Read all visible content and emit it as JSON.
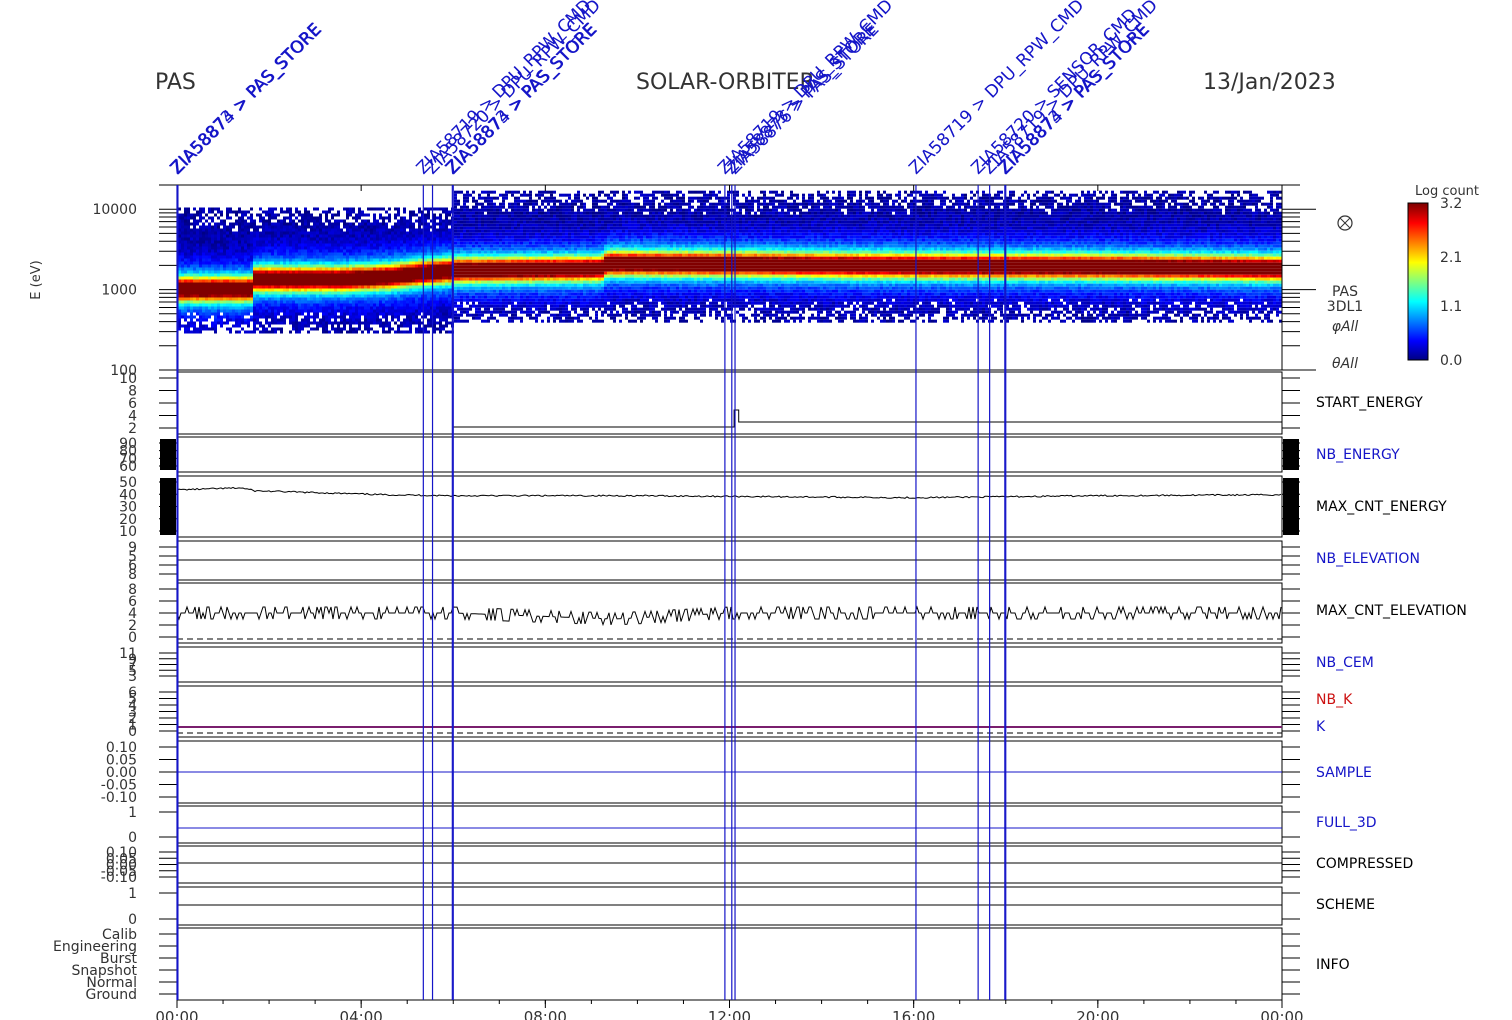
{
  "header": {
    "left": "PAS",
    "center": "SOLAR-ORBITER",
    "right": "13/Jan/2023"
  },
  "chart_data": {
    "type": "heatmap",
    "title": "SOLAR-ORBITER",
    "instrument": "PAS",
    "date": "13/Jan/2023",
    "x_ticks": [
      "00:00",
      "04:00",
      "08:00",
      "12:00",
      "16:00",
      "20:00",
      "00:00"
    ],
    "x_range_hours": [
      0,
      24
    ],
    "spectrogram": {
      "ylabel": "E (eV)",
      "y_ticks": [
        "10000",
        "1000",
        "100"
      ],
      "y_scale": "log",
      "ylim": [
        100,
        20000
      ],
      "labels": [
        "PAS",
        "3DL1",
        "φAll",
        "θAll"
      ],
      "colorbar": {
        "title": "Log count",
        "ticks": [
          "3.2",
          "2.1",
          "1.1",
          "0.0"
        ],
        "range": [
          0.0,
          3.2
        ]
      },
      "peak_energy_ev": [
        [
          0.0,
          1050
        ],
        [
          1.6,
          1050
        ],
        [
          1.65,
          1400
        ],
        [
          3.5,
          1400
        ],
        [
          4.6,
          1500
        ],
        [
          5.2,
          1650
        ],
        [
          6.0,
          1800
        ],
        [
          9.2,
          1900
        ],
        [
          9.3,
          2200
        ],
        [
          12.0,
          2150
        ],
        [
          16.0,
          2050
        ],
        [
          20.0,
          2000
        ],
        [
          24.0,
          1900
        ]
      ]
    },
    "panels": [
      {
        "name": "START_ENERGY",
        "label_color": "#000000",
        "y_ticks": [
          "10",
          "8",
          "6",
          "4",
          "2"
        ]
      },
      {
        "name": "NB_ENERGY",
        "label_color": "#1515c8",
        "y_ticks": [
          "90",
          "80",
          "70",
          "60"
        ]
      },
      {
        "name": "MAX_CNT_ENERGY",
        "label_color": "#000000",
        "y_ticks": [
          "50",
          "40",
          "30",
          "20",
          "10"
        ],
        "values_approx": [
          [
            0,
            47
          ],
          [
            1.4,
            49
          ],
          [
            1.7,
            46
          ],
          [
            4.5,
            42
          ],
          [
            6,
            41
          ],
          [
            10,
            41
          ],
          [
            16,
            39
          ],
          [
            20,
            41
          ],
          [
            24,
            42
          ]
        ]
      },
      {
        "name": "NB_ELEVATION",
        "label_color": "#1515c8",
        "y_ticks": [
          "9",
          "5",
          "6",
          "8"
        ]
      },
      {
        "name": "MAX_CNT_ELEVATION",
        "label_color": "#000000",
        "y_ticks": [
          "8",
          "6",
          "4",
          "2",
          "0"
        ],
        "values_approx": [
          [
            0,
            4
          ],
          [
            6,
            4
          ],
          [
            9.5,
            3
          ],
          [
            12,
            4
          ],
          [
            24,
            4
          ]
        ]
      },
      {
        "name": "NB_CEM",
        "label_color": "#1515c8",
        "y_ticks": [
          "11",
          "9",
          "7",
          "5",
          "3"
        ]
      },
      {
        "name": "NB_K",
        "label_color": "#cc1111",
        "y_ticks": [
          "6",
          "5",
          "4",
          "3",
          "2",
          "1",
          "0"
        ]
      },
      {
        "name": "K",
        "label_color": "#1515c8",
        "y_ticks": []
      },
      {
        "name": "SAMPLE",
        "label_color": "#1515c8",
        "y_ticks": [
          "0.10",
          "0.05",
          "0.00",
          "-0.05",
          "-0.10"
        ]
      },
      {
        "name": "FULL_3D",
        "label_color": "#1515c8",
        "y_ticks": [
          "1",
          "0"
        ]
      },
      {
        "name": "COMPRESSED",
        "label_color": "#000000",
        "y_ticks": [
          "0.10",
          "0.05",
          "0.00",
          "-0.05",
          "-0.10"
        ]
      },
      {
        "name": "SCHEME",
        "label_color": "#000000",
        "y_ticks": [
          "1",
          "0"
        ]
      },
      {
        "name": "INFO",
        "label_color": "#000000",
        "y_ticks": [
          "Calib",
          "Engineering",
          "Burst",
          "Snapshot",
          "Normal",
          "Ground"
        ]
      }
    ],
    "events": [
      {
        "t": 0.0,
        "label": "ZIA58873 > PAS_STORE"
      },
      {
        "t": 0.02,
        "label": "ZIA58874 > PAS_STORE"
      },
      {
        "t": 5.35,
        "label": "ZIA58719 > DPU_RPW_CMD"
      },
      {
        "t": 5.55,
        "label": "ZIA58720 > DPU_RPW_CMD"
      },
      {
        "t": 5.98,
        "label": "ZIA58873 > PAS_STORE"
      },
      {
        "t": 6.0,
        "label": "ZIA58874 > PAS_STORE"
      },
      {
        "t": 11.9,
        "label": "ZIA58719 > DPU_RPW_CMD"
      },
      {
        "t": 12.05,
        "label": "ZIA58873 > PAS_STORE"
      },
      {
        "t": 12.12,
        "label": "ZIA58876 > PAS_STORE"
      },
      {
        "t": 16.05,
        "label": "ZIA58719 > DPU_RPW_CMD"
      },
      {
        "t": 17.4,
        "label": "ZIA58720 > SENSOR_CMD"
      },
      {
        "t": 17.65,
        "label": "ZIA58719 > DPU_RPW_CMD"
      },
      {
        "t": 17.98,
        "label": "ZIA58873 > PAS_STORE"
      },
      {
        "t": 18.0,
        "label": "ZIA58874 > PAS_STORE"
      }
    ]
  }
}
